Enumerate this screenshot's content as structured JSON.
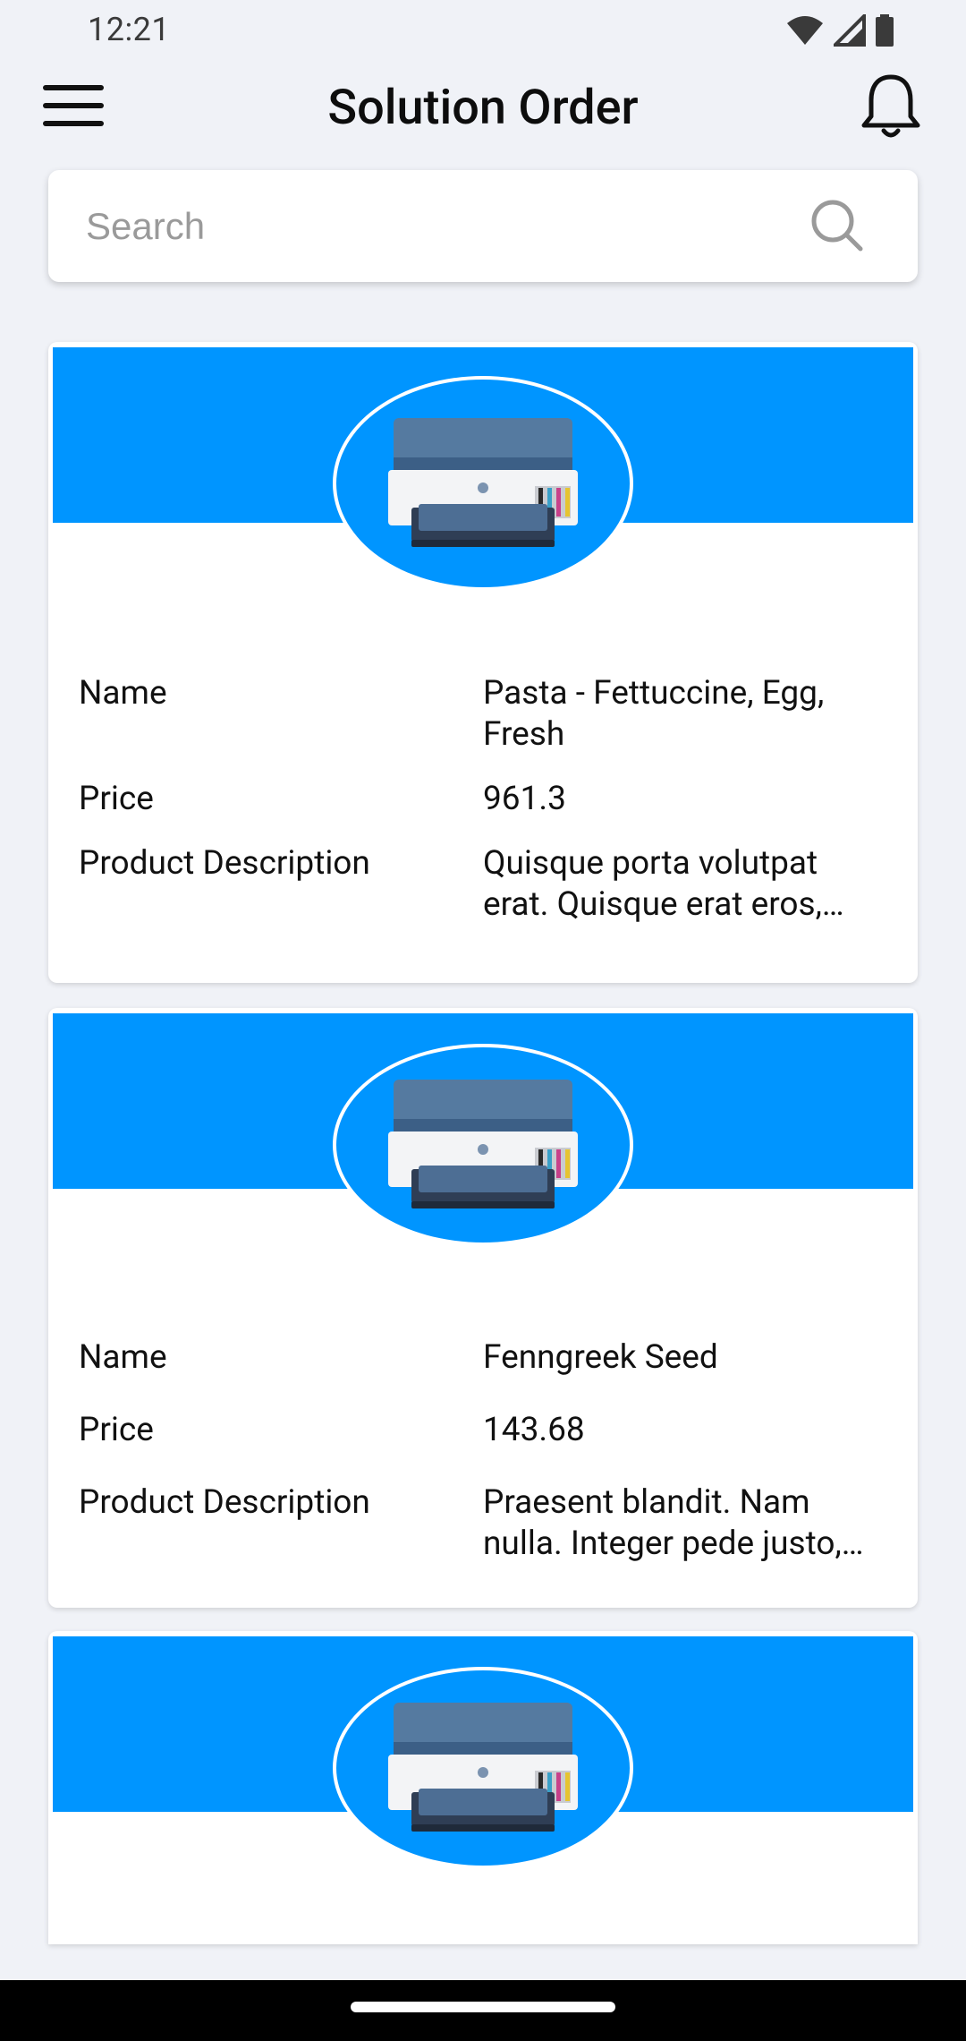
{
  "status_bar": {
    "time": "12:21",
    "icons": [
      "wifi-icon",
      "signal-icon",
      "battery-icon"
    ]
  },
  "app_bar": {
    "title": "Solution Order",
    "menu_icon": "hamburger-menu-icon",
    "notification_icon": "bell-icon"
  },
  "search": {
    "placeholder": "Search",
    "value": "",
    "icon": "search-icon"
  },
  "colors": {
    "banner": "#0095ff",
    "background": "#f0f2f7",
    "card": "#ffffff"
  },
  "product_labels": {
    "name": "Name",
    "price": "Price",
    "description": "Product Description"
  },
  "products": [
    {
      "image": "printer-image",
      "name": "Pasta - Fettuccine, Egg, Fresh",
      "price": "961.3",
      "description": "Quisque porta volutpat erat. Quisque erat eros, viverra eget"
    },
    {
      "image": "printer-image",
      "name": "Fenngreek Seed",
      "price": "143.68",
      "description": "Praesent blandit. Nam nulla. Integer pede justo, lacinia eget"
    },
    {
      "image": "printer-image"
    }
  ]
}
